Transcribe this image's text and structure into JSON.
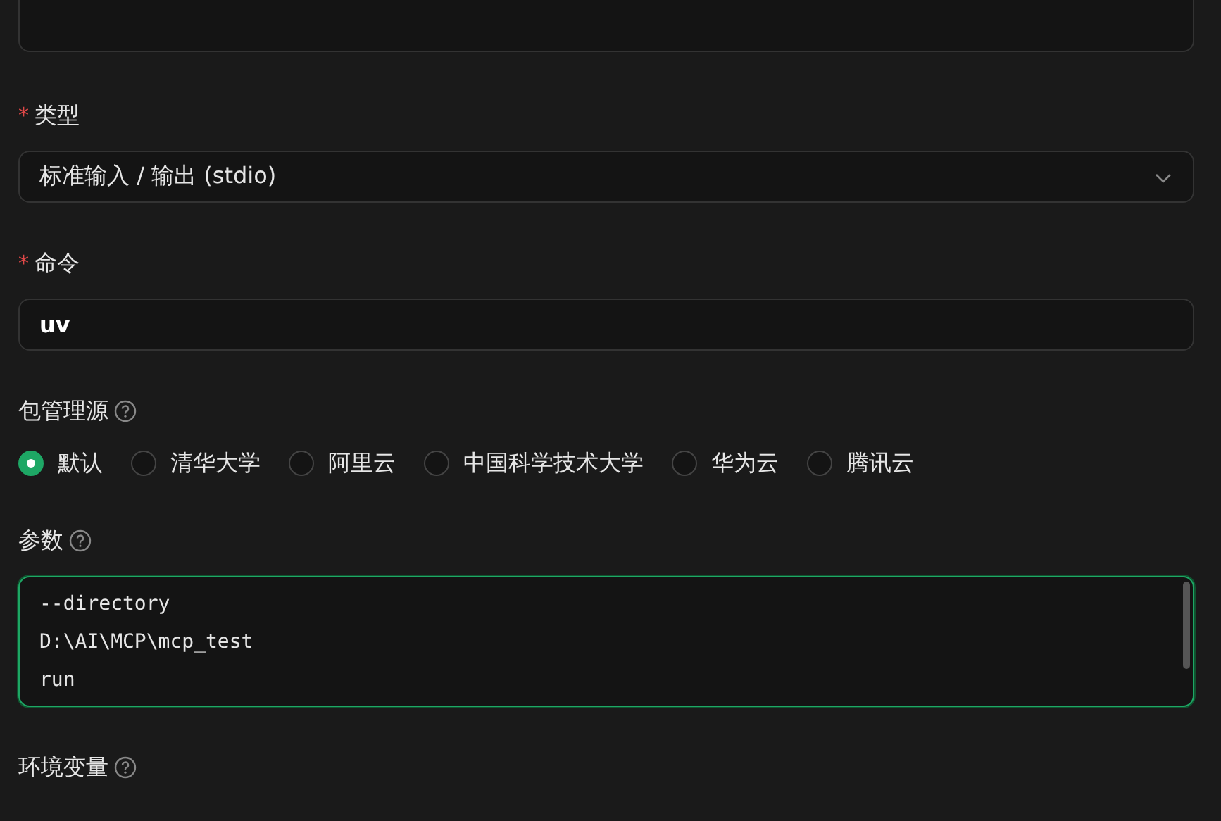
{
  "fields": [
    {
      "kind": "select",
      "label": "类型",
      "required_mark": "*",
      "help": false,
      "value": "标准输入 / 输出 (stdio)"
    },
    {
      "kind": "input",
      "label": "命令",
      "required_mark": "*",
      "help": false,
      "value": "uv"
    },
    {
      "kind": "radio",
      "label": "包管理源",
      "help": true,
      "options": [
        {
          "label": "默认",
          "selected": true
        },
        {
          "label": "清华大学",
          "selected": false
        },
        {
          "label": "阿里云",
          "selected": false
        },
        {
          "label": "中国科学技术大学",
          "selected": false
        },
        {
          "label": "华为云",
          "selected": false
        },
        {
          "label": "腾讯云",
          "selected": false
        }
      ]
    },
    {
      "kind": "textarea",
      "label": "参数",
      "help": true,
      "focused": true,
      "lines": [
        "--directory",
        "D:\\AI\\MCP\\mcp_test",
        "run"
      ]
    },
    {
      "kind": "label_only",
      "label": "环境变量",
      "help": true
    }
  ]
}
